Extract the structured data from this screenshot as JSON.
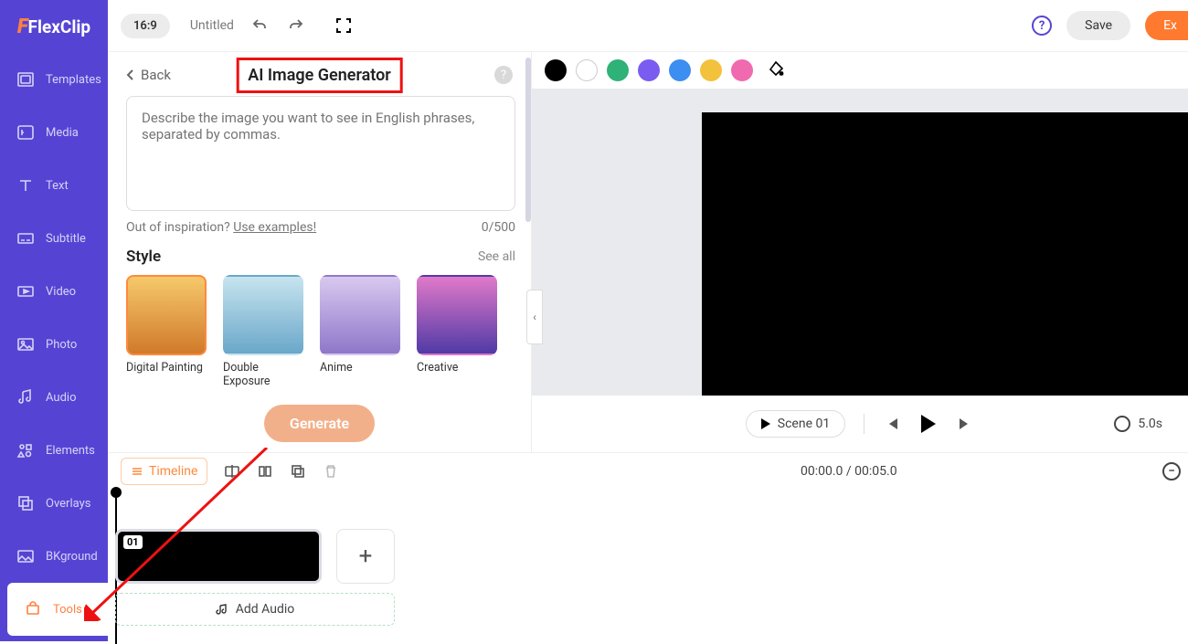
{
  "brand": {
    "name": "FlexClip"
  },
  "sidebar": {
    "items": [
      {
        "label": "Templates",
        "icon": "templates-icon"
      },
      {
        "label": "Media",
        "icon": "media-icon"
      },
      {
        "label": "Text",
        "icon": "text-icon"
      },
      {
        "label": "Subtitle",
        "icon": "subtitle-icon"
      },
      {
        "label": "Video",
        "icon": "video-icon"
      },
      {
        "label": "Photo",
        "icon": "photo-icon"
      },
      {
        "label": "Audio",
        "icon": "audio-icon"
      },
      {
        "label": "Elements",
        "icon": "elements-icon"
      },
      {
        "label": "Overlays",
        "icon": "overlays-icon"
      },
      {
        "label": "BKground",
        "icon": "background-icon"
      },
      {
        "label": "Tools",
        "icon": "tools-icon"
      }
    ]
  },
  "topbar": {
    "ratio": "16:9",
    "title": "Untitled",
    "save": "Save",
    "export": "Ex"
  },
  "panel": {
    "back": "Back",
    "title": "AI Image Generator",
    "placeholder": "Describe the image you want to see in English phrases, separated by commas.",
    "inspiration_prefix": "Out of inspiration? ",
    "inspiration_link": "Use examples!",
    "counter": "0/500",
    "style_label": "Style",
    "see_all": "See all",
    "styles": [
      {
        "name": "Digital Painting"
      },
      {
        "name": "Double Exposure"
      },
      {
        "name": "Anime"
      },
      {
        "name": "Creative"
      }
    ],
    "generate": "Generate"
  },
  "colors": [
    "#000000",
    "#ffffff",
    "#2fb277",
    "#7a5cf0",
    "#3c8ef0",
    "#f2c23c",
    "#f06aaf"
  ],
  "playbar": {
    "scene_label": "Scene 01",
    "duration": "5.0s"
  },
  "timeline_toolbar": {
    "timeline": "Timeline",
    "time": "00:00.0 / 00:05.0"
  },
  "timeline": {
    "clip_num": "01",
    "add_audio": "Add Audio"
  }
}
